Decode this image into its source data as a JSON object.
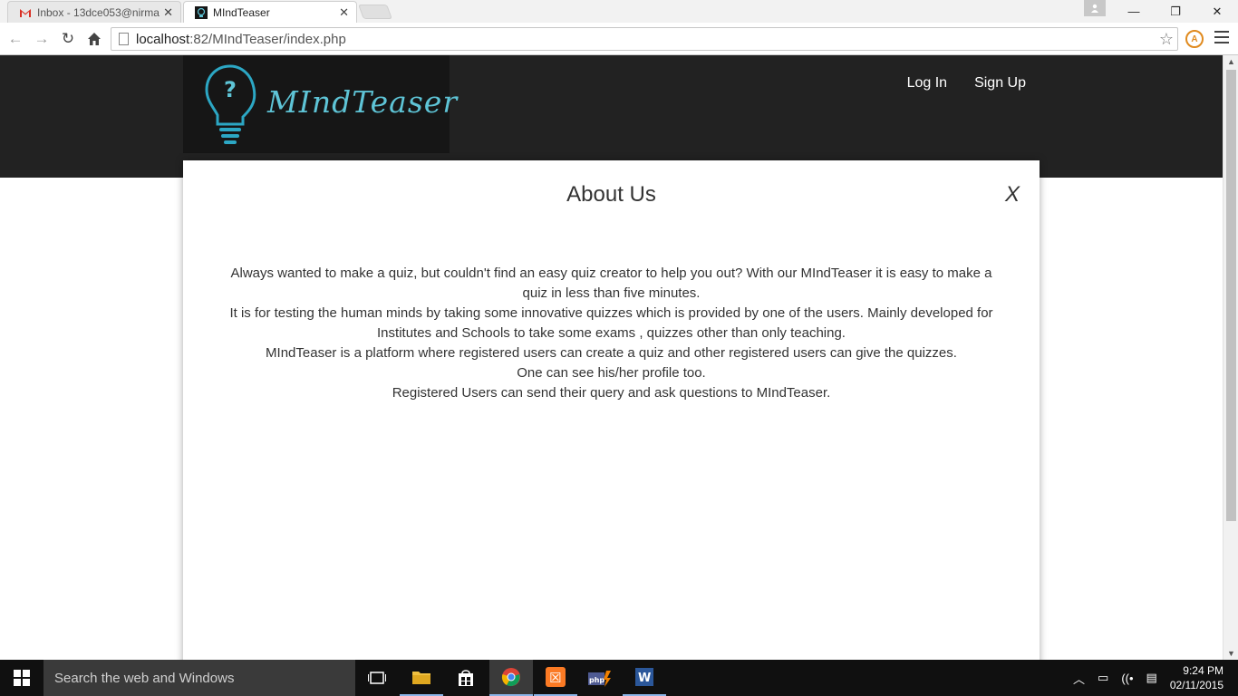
{
  "browser": {
    "tabs": [
      {
        "title": "Inbox - 13dce053@nirma",
        "active": false
      },
      {
        "title": "MIndTeaser",
        "active": true
      }
    ],
    "url_host": "localhost",
    "url_rest": ":82/MIndTeaser/index.php"
  },
  "site": {
    "brand": "MIndTeaser",
    "nav": {
      "login": "Log In",
      "signup": "Sign Up"
    }
  },
  "modal": {
    "title": "About Us",
    "close_label": "X",
    "paragraphs": [
      "Always wanted to make a quiz, but couldn't find an easy quiz creator to help you out? With our MIndTeaser it is easy to make a quiz in less than five minutes.",
      "It is for testing the human minds by taking some innovative quizzes which is provided by one of the users. Mainly developed for Institutes and Schools to take some exams , quizzes other than only teaching.",
      "MIndTeaser is a platform where registered users can create a quiz and other registered users can give the quizzes.",
      "One can see his/her profile too.",
      "Registered Users can send their query and ask questions to MIndTeaser."
    ]
  },
  "taskbar": {
    "search_placeholder": "Search the web and Windows",
    "time": "9:24 PM",
    "date": "02/11/2015"
  },
  "colors": {
    "header_bg": "#222222",
    "brand_color": "#5ec4d6"
  }
}
